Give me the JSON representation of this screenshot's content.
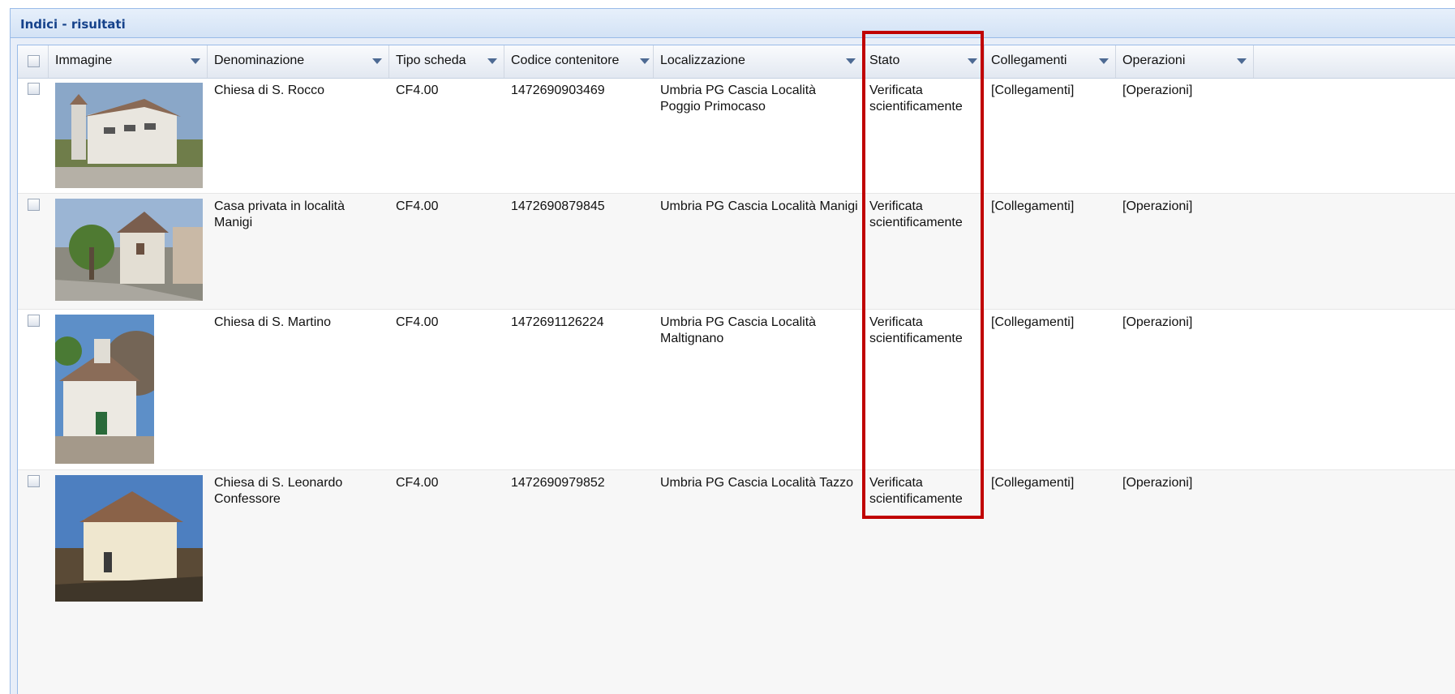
{
  "panel": {
    "title": "Indici - risultati"
  },
  "columns": [
    "Immagine",
    "Denominazione",
    "Tipo scheda",
    "Codice contenitore",
    "Localizzazione",
    "Stato",
    "Collegamenti",
    "Operazioni"
  ],
  "rows": [
    {
      "denominazione": "Chiesa di S. Rocco",
      "tipo": "CF4.00",
      "codice": "1472690903469",
      "localizzazione": "Umbria PG Cascia Località Poggio Primocaso",
      "stato": "Verificata scientificamente",
      "collegamenti": "[Collegamenti]",
      "operazioni": "[Operazioni]",
      "image": "church-photo"
    },
    {
      "denominazione": "Casa privata in località Manigi",
      "tipo": "CF4.00",
      "codice": "1472690879845",
      "localizzazione": "Umbria PG Cascia Località Manigi",
      "stato": "Verificata scientificamente",
      "collegamenti": "[Collegamenti]",
      "operazioni": "[Operazioni]",
      "image": "house-photo"
    },
    {
      "denominazione": "Chiesa di S. Martino",
      "tipo": "CF4.00",
      "codice": "1472691126224",
      "localizzazione": "Umbria PG Cascia Località Maltignano",
      "stato": "Verificata scientificamente",
      "collegamenti": "[Collegamenti]",
      "operazioni": "[Operazioni]",
      "image": "church-photo"
    },
    {
      "denominazione": "Chiesa di S. Leonardo Confessore",
      "tipo": "CF4.00",
      "codice": "1472690979852",
      "localizzazione": "Umbria PG Cascia Località Tazzo",
      "stato": "Verificata scientificamente",
      "collegamenti": "[Collegamenti]",
      "operazioni": "[Operazioni]",
      "image": "church-photo"
    }
  ],
  "colors": {
    "header_text": "#15428b",
    "border": "#99bbe8",
    "highlight": "#c00000"
  }
}
